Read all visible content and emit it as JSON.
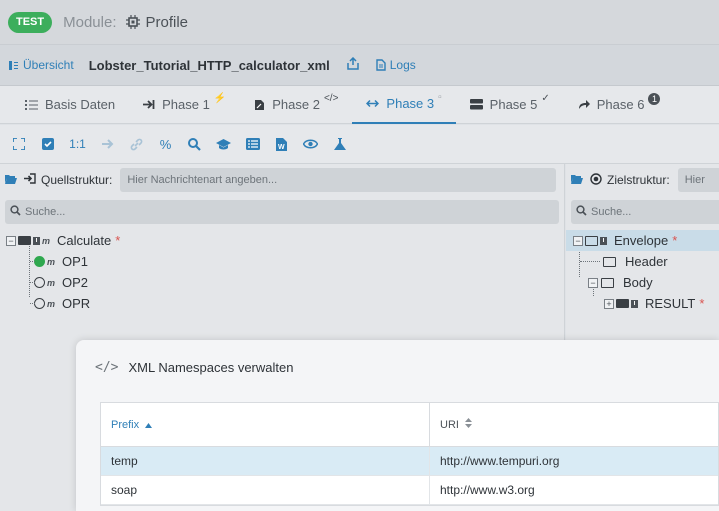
{
  "topbar": {
    "env_badge": "TEST",
    "module_label": "Module:",
    "module_value": "Profile"
  },
  "subbar": {
    "overview_label": "Übersicht",
    "project_title": "Lobster_Tutorial_HTTP_calculator_xml",
    "logs_label": "Logs"
  },
  "tabs": [
    {
      "label": "Basis Daten"
    },
    {
      "label": "Phase 1"
    },
    {
      "label": "Phase 2"
    },
    {
      "label": "Phase 3",
      "active": true
    },
    {
      "label": "Phase 5"
    },
    {
      "label": "Phase 6",
      "badge": "1"
    }
  ],
  "toolbar": {
    "ratio_label": "1:1"
  },
  "source": {
    "label": "Quellstruktur:",
    "placeholder": "Hier Nachrichtenart angeben...",
    "search_placeholder": "Suche...",
    "tree": [
      {
        "label": "Calculate",
        "required": "*"
      },
      {
        "label": "OP1"
      },
      {
        "label": "OP2"
      },
      {
        "label": "OPR"
      }
    ]
  },
  "target": {
    "label": "Zielstruktur:",
    "placeholder": "Hier",
    "search_placeholder": "Suche...",
    "tree": [
      {
        "label": "Envelope",
        "required": "*"
      },
      {
        "label": "Header"
      },
      {
        "label": "Body"
      },
      {
        "label": "RESULT",
        "required": "*"
      }
    ]
  },
  "modal": {
    "title": "XML Namespaces verwalten",
    "columns": {
      "prefix": "Prefix",
      "uri": "URI"
    },
    "rows": [
      {
        "prefix": "temp",
        "uri": "http://www.tempuri.org"
      },
      {
        "prefix": "soap",
        "uri": "http://www.w3.org"
      }
    ]
  },
  "colors": {
    "accent": "#2f7fb7",
    "badge_green": "#3cae5c",
    "required_red": "#d9534f",
    "selected_row": "#d9ebf5"
  }
}
